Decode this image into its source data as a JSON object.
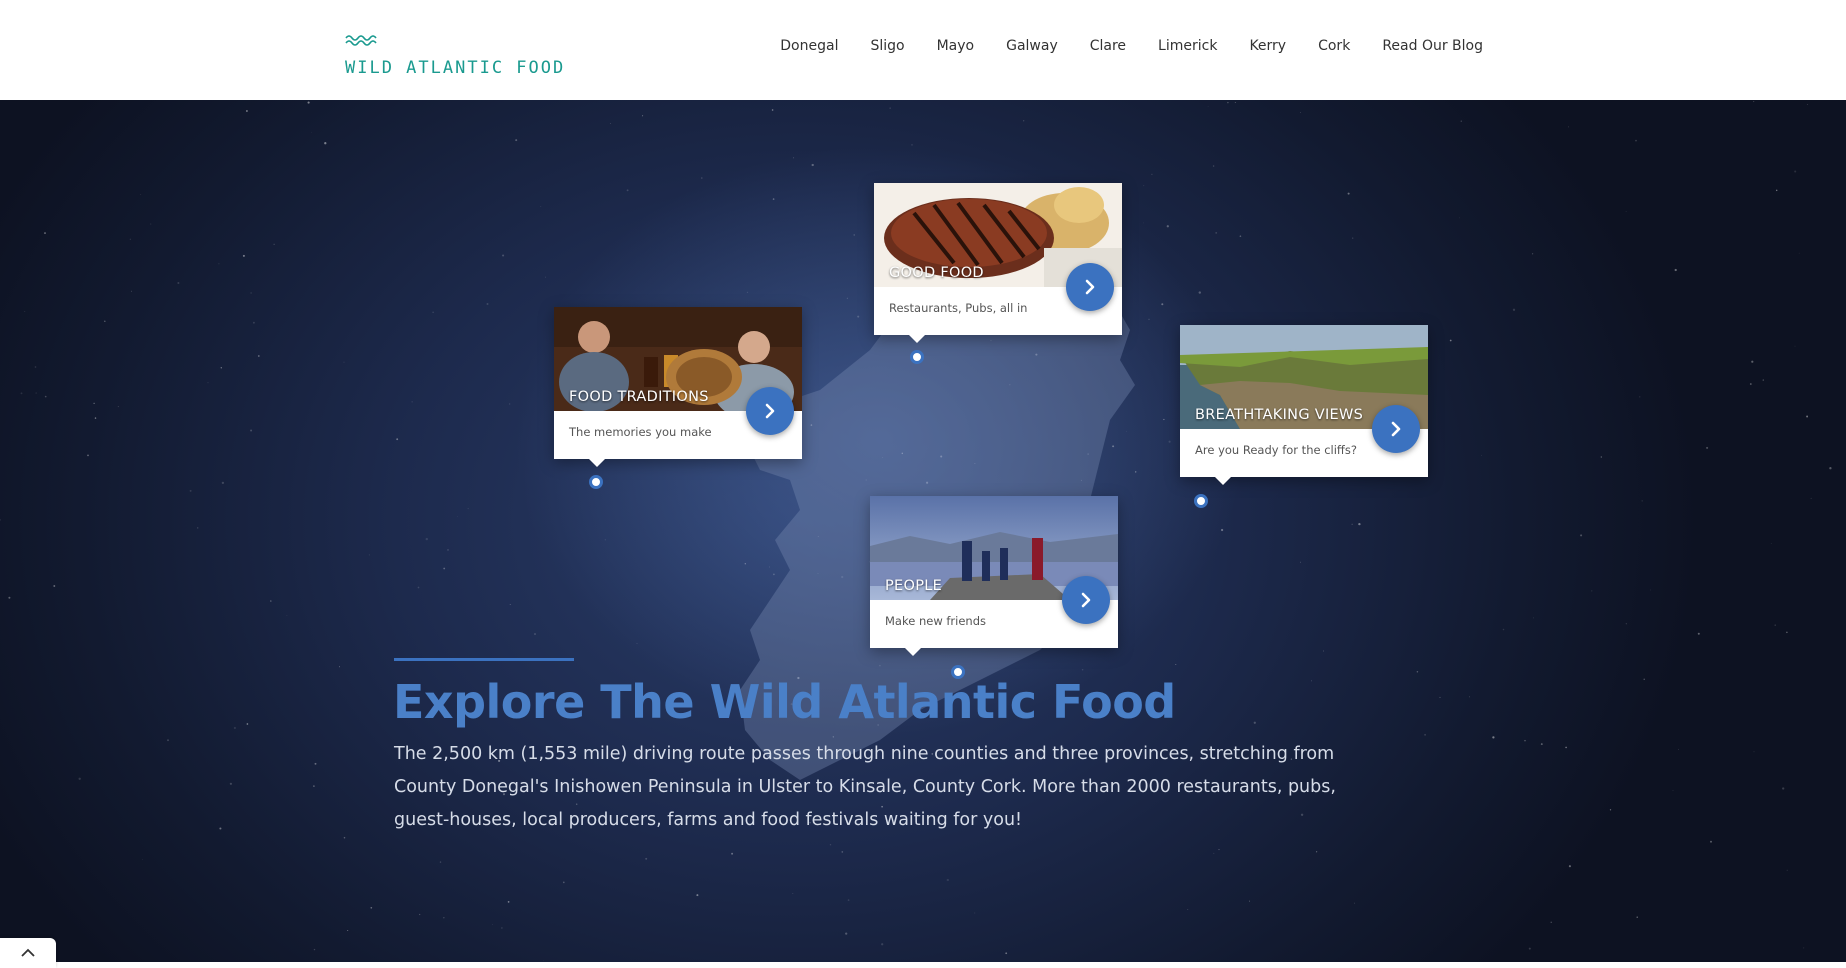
{
  "header": {
    "logo_text": "WILD ATLANTIC FOOD",
    "nav": [
      "Donegal",
      "Sligo",
      "Mayo",
      "Galway",
      "Clare",
      "Limerick",
      "Kerry",
      "Cork",
      "Read Our Blog"
    ]
  },
  "cards": [
    {
      "title": "GOOD FOOD",
      "subtitle": "Restaurants, Pubs, all in",
      "image": "grilled-steak-photo"
    },
    {
      "title": "FOOD TRADITIONS",
      "subtitle": "The memories you make",
      "image": "pub-gathering-photo"
    },
    {
      "title": "BREATHTAKING VIEWS",
      "subtitle": "Are you Ready for the cliffs?",
      "image": "sea-cliffs-photo"
    },
    {
      "title": "PEOPLE",
      "subtitle": "Make new friends",
      "image": "friends-by-lake-photo"
    }
  ],
  "hero": {
    "title": "Explore The Wild Atlantic Food",
    "description": "The 2,500 km (1,553 mile) driving route passes through nine counties and three provinces, stretching from County Donegal's Inishowen Peninsula in Ulster to Kinsale, County Cork. More than 2000 restaurants, pubs, guest-houses, local producers, farms and food festivals waiting for you!"
  },
  "colors": {
    "accent": "#3b72c0",
    "title": "#4a80c8",
    "logo": "#1a9a8f",
    "hero_bg": "#1d2a4d"
  },
  "icons": {
    "card_arrow": "chevron-right-icon",
    "scroll_top": "chevron-up-icon",
    "logo": "waves-icon"
  }
}
